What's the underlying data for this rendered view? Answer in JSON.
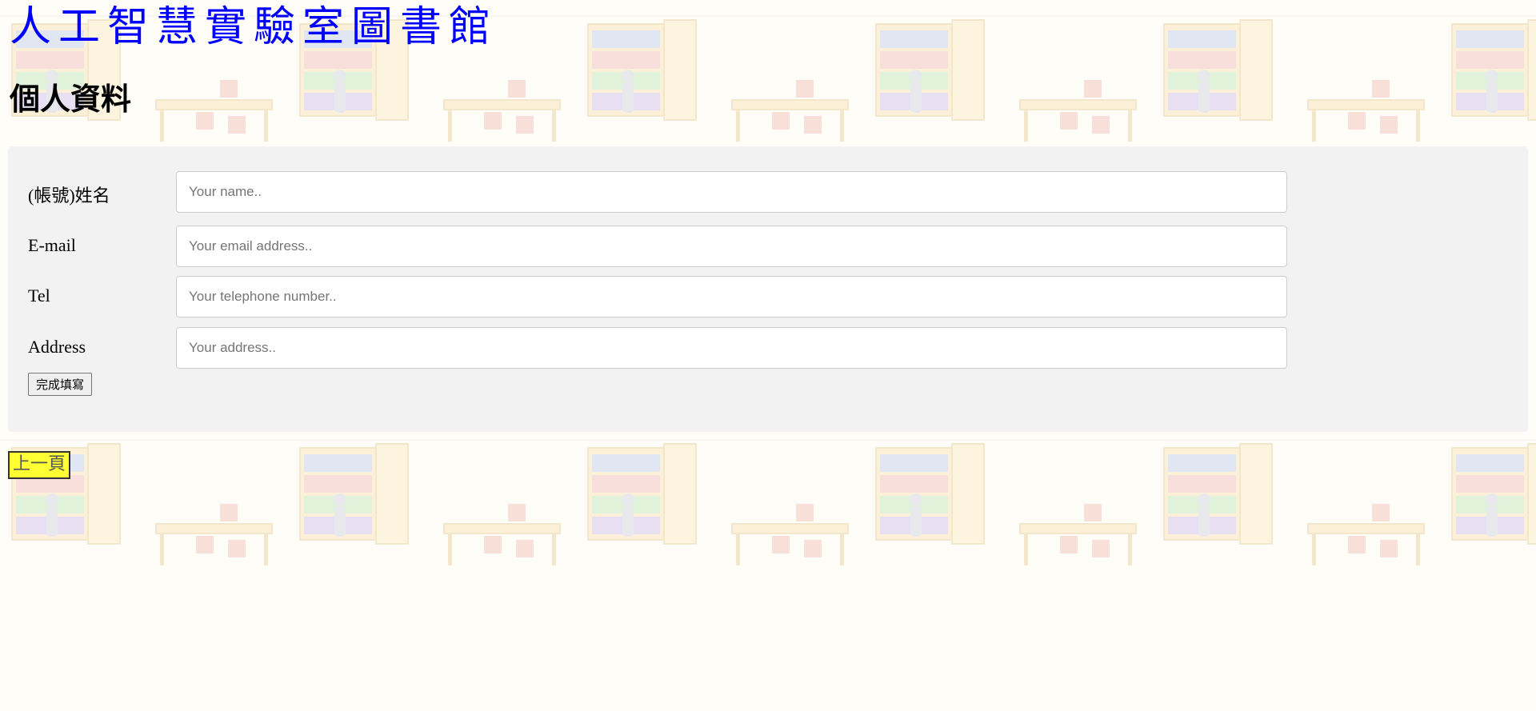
{
  "site_title": "人工智慧實驗室圖書館",
  "page_heading": "個人資料",
  "form": {
    "fields": [
      {
        "label": "(帳號)姓名",
        "placeholder": "Your name..",
        "value": ""
      },
      {
        "label": "E-mail",
        "placeholder": "Your email address..",
        "value": ""
      },
      {
        "label": "Tel",
        "placeholder": "Your telephone number..",
        "value": ""
      },
      {
        "label": "Address",
        "placeholder": "Your address..",
        "value": ""
      }
    ],
    "submit_label": "完成填寫"
  },
  "back_link_label": "上一頁",
  "colors": {
    "title": "#0000ff",
    "panel": "#f2f2f2",
    "back_link_bg": "#ffff33"
  },
  "background_image": "library-bookshelf-pattern"
}
